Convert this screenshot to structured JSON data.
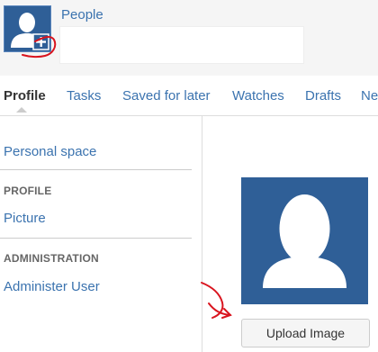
{
  "header": {
    "people_link": "People",
    "avatar_icon": "user-avatar-icon",
    "add_badge_icon": "plus-box-icon",
    "name_field_value": ""
  },
  "tabs": [
    {
      "label": "Profile",
      "active": true
    },
    {
      "label": "Tasks"
    },
    {
      "label": "Saved for later"
    },
    {
      "label": "Watches"
    },
    {
      "label": "Drafts"
    },
    {
      "label": "Ne"
    }
  ],
  "sidebar": {
    "personal_space": "Personal space",
    "profile_heading": "PROFILE",
    "picture_link": "Picture",
    "admin_heading": "ADMINISTRATION",
    "administer_link": "Administer User"
  },
  "main": {
    "avatar_icon": "user-silhouette-icon",
    "upload_button": "Upload Image"
  },
  "colors": {
    "brand_blue": "#2f5f97",
    "link": "#3b73af",
    "annotation_red": "#d9141e"
  }
}
